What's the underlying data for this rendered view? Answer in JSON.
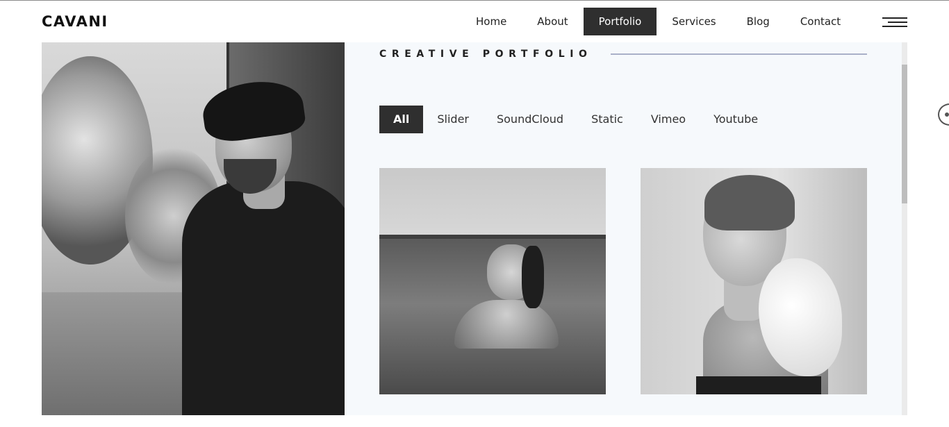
{
  "brand": {
    "logo": "CAVANI"
  },
  "nav": {
    "items": [
      {
        "label": "Home",
        "active": false
      },
      {
        "label": "About",
        "active": false
      },
      {
        "label": "Portfolio",
        "active": true
      },
      {
        "label": "Services",
        "active": false
      },
      {
        "label": "Blog",
        "active": false
      },
      {
        "label": "Contact",
        "active": false
      }
    ],
    "menu_icon": "hamburger-icon"
  },
  "portfolio": {
    "title": "CREATIVE PORTFOLIO",
    "filters": [
      {
        "label": "All",
        "active": true
      },
      {
        "label": "Slider",
        "active": false
      },
      {
        "label": "SoundCloud",
        "active": false
      },
      {
        "label": "Static",
        "active": false
      },
      {
        "label": "Vimeo",
        "active": false
      },
      {
        "label": "Youtube",
        "active": false
      }
    ],
    "items": [
      {
        "image": "woman-in-water-photo"
      },
      {
        "image": "woman-with-white-bow-photo"
      }
    ]
  },
  "hero": {
    "image": "man-portrait-photo"
  },
  "colors": {
    "accent": "#2f2f2f",
    "panel_bg": "#f6f9fc",
    "title_line": "#a9b0c8"
  }
}
